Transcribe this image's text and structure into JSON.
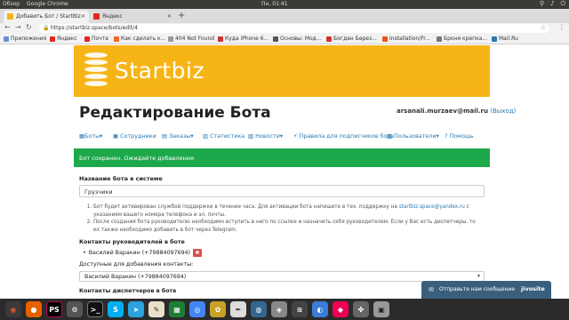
{
  "os": {
    "overview": "Обзор",
    "app": "Google Chrome",
    "clock": "Пн, 01:41"
  },
  "tabs": [
    {
      "title": "Добавить Бот / StartBiz",
      "active": true
    },
    {
      "title": "Яндекс",
      "active": false
    }
  ],
  "address": {
    "url": "https://startbiz.space/bots/edit/4"
  },
  "bookmarks": [
    "Приложения",
    "Яндекс",
    "Почта",
    "Как сделать к...",
    "404 Not Found",
    "Куда iPhone 6...",
    "Основы: Мод...",
    "Богдан Берез...",
    "Installation/Fr...",
    "Броня крепка...",
    "Mail.Ru"
  ],
  "brand": {
    "logo": "Startbiz",
    "accent": "#f7b416",
    "success": "#1ea84c"
  },
  "page": {
    "title": "Редактирование Бота"
  },
  "user": {
    "email": "arsanali.murzaev@mail.ru",
    "logout": "(Выход)"
  },
  "nav": [
    {
      "label": "Боты",
      "icon": "bots-icon",
      "dropdown": true
    },
    {
      "label": "Сотрудники",
      "icon": "staff-icon",
      "dropdown": false
    },
    {
      "label": "Заказы",
      "icon": "orders-icon",
      "dropdown": true
    },
    {
      "label": "Статистика",
      "icon": "stats-icon",
      "dropdown": false
    },
    {
      "label": "Новости",
      "icon": "news-icon",
      "dropdown": true
    },
    {
      "label": "Правила для подписчиков бота",
      "icon": "rules-icon",
      "dropdown": false
    },
    {
      "label": "Пользователи",
      "icon": "users-icon",
      "dropdown": true
    },
    {
      "label": "Помощь",
      "icon": "help-icon",
      "dropdown": false
    }
  ],
  "alert": "Бот сохранен. Ожидайте добавления",
  "form": {
    "bot_name_label": "Название бота в системе",
    "bot_name_value": "Грузчики",
    "info1_pre": "Бот будет активирован службой поддержки в течение часа. Для активации бота напишите в тех. поддержку на ",
    "info1_link": "startbiz.space@yandex.ru",
    "info1_post": " с указанием вашего номера телефона и эл. почты.",
    "info2": "После создания бота руководителю необходимо вступить в него по ссылке и назначить себя руководителем. Если у Вас есть диспетчеры, то их также необходимо добавить в бот через Telegram.",
    "managers_label": "Контакты руководителей в боте",
    "manager": "Василий Варакин (+79884097694)",
    "delete": "✖",
    "available_label": "Доступные для добавления контакты:",
    "available_value": "Василий Варакин (+79884097694)",
    "dispatchers_label": "Контакты диспетчеров в боте"
  },
  "chat": {
    "label": "Отправьте нам сообщение",
    "brand": "jivosite"
  }
}
